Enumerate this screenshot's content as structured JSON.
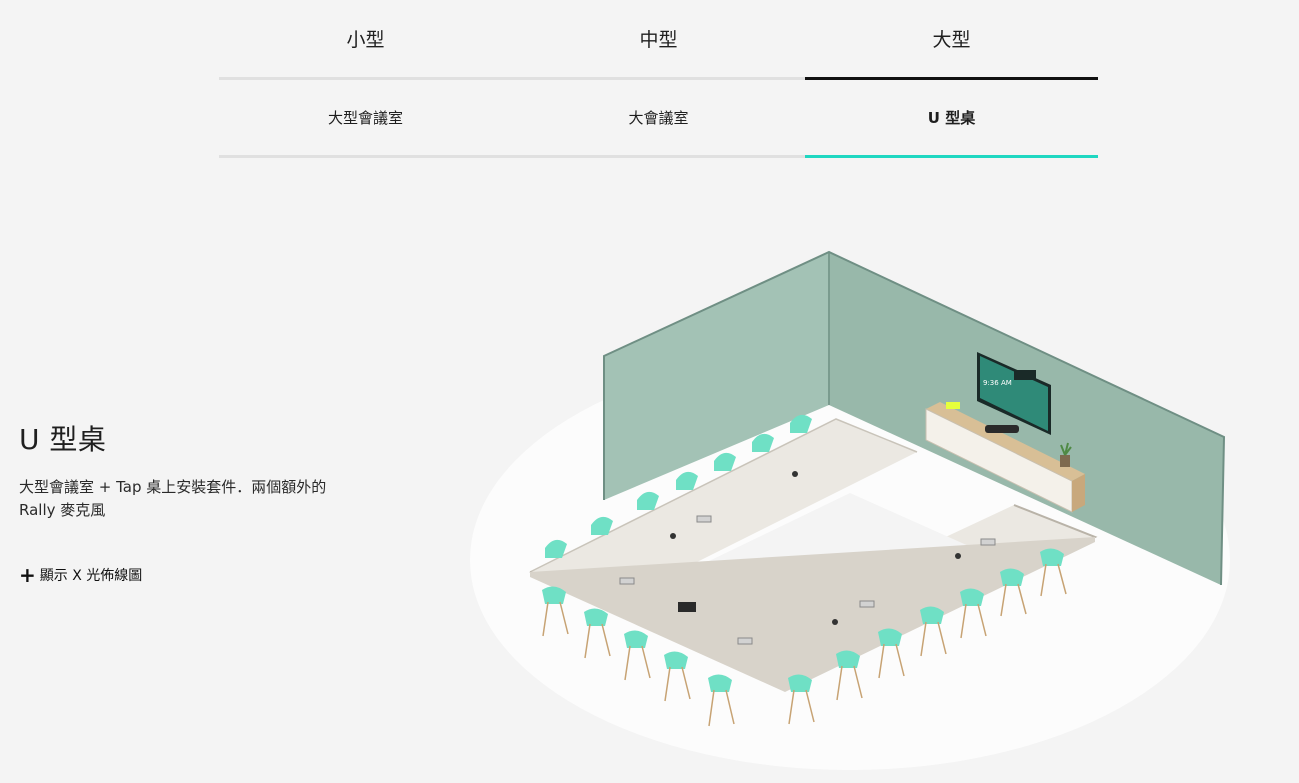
{
  "size_tabs": [
    {
      "label": "小型",
      "active": false
    },
    {
      "label": "中型",
      "active": false
    },
    {
      "label": "大型",
      "active": true
    }
  ],
  "room_tabs": [
    {
      "label": "大型會議室",
      "active": false
    },
    {
      "label": "大會議室",
      "active": false
    },
    {
      "label": "U 型桌",
      "active": true
    }
  ],
  "room": {
    "title": "U 型桌",
    "description": "大型會議室 + Tap 桌上安裝套件．兩個額外的 Rally 麥克風"
  },
  "xray_toggle": {
    "icon": "plus-icon",
    "label": "顯示 X 光佈線圖"
  },
  "scene": {
    "tv_clock": "9:36 AM",
    "colors": {
      "wall": "#9fbfb1",
      "wall_edge": "#6f8f84",
      "table": "#ece9e3",
      "chair": "#6fe0c5",
      "tab_accent": "#1fd7c1"
    }
  }
}
